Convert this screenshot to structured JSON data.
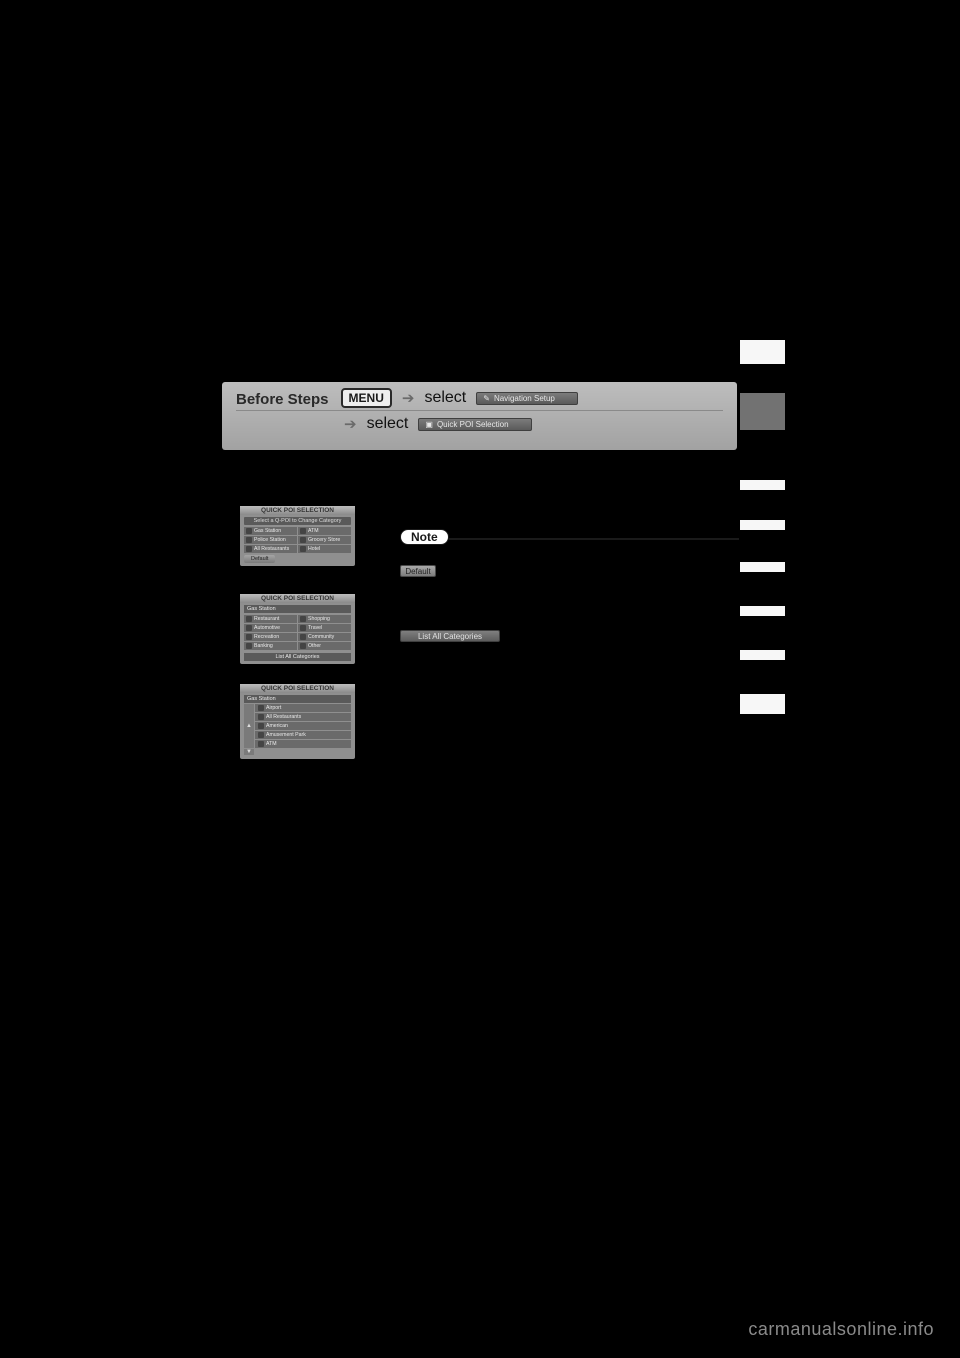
{
  "panel": {
    "before_steps": "Before Steps",
    "menu_label": "MENU",
    "select_word": "select",
    "chip1": {
      "icon": "✎",
      "label": "Navigation Setup"
    },
    "chip2": {
      "icon": "▣",
      "label": "Quick POI Selection"
    }
  },
  "note": {
    "label": "Note"
  },
  "right_buttons": {
    "default_label": "Default",
    "list_all_label": "List All Categories"
  },
  "mini1": {
    "title": "QUICK POI SELECTION",
    "subtitle": "Select a Q-POI to Change Category",
    "cells": [
      "Gas Station",
      "ATM",
      "Police Station",
      "Grocery Store",
      "All Restaurants",
      "Hotel"
    ],
    "default_btn": "Default"
  },
  "mini2": {
    "title": "QUICK POI SELECTION",
    "header": "Gas Station",
    "cells": [
      "Restaurant",
      "Shopping",
      "Automotive",
      "Travel",
      "Recreation",
      "Community",
      "Banking",
      "Other"
    ],
    "list_all": "List All Categories"
  },
  "mini3": {
    "title": "QUICK POI SELECTION",
    "header": "Gas Station",
    "rows": [
      "Airport",
      "All Restaurants",
      "American",
      "Amusement Park",
      "ATM"
    ]
  },
  "footer": "carmanualsonline.info"
}
